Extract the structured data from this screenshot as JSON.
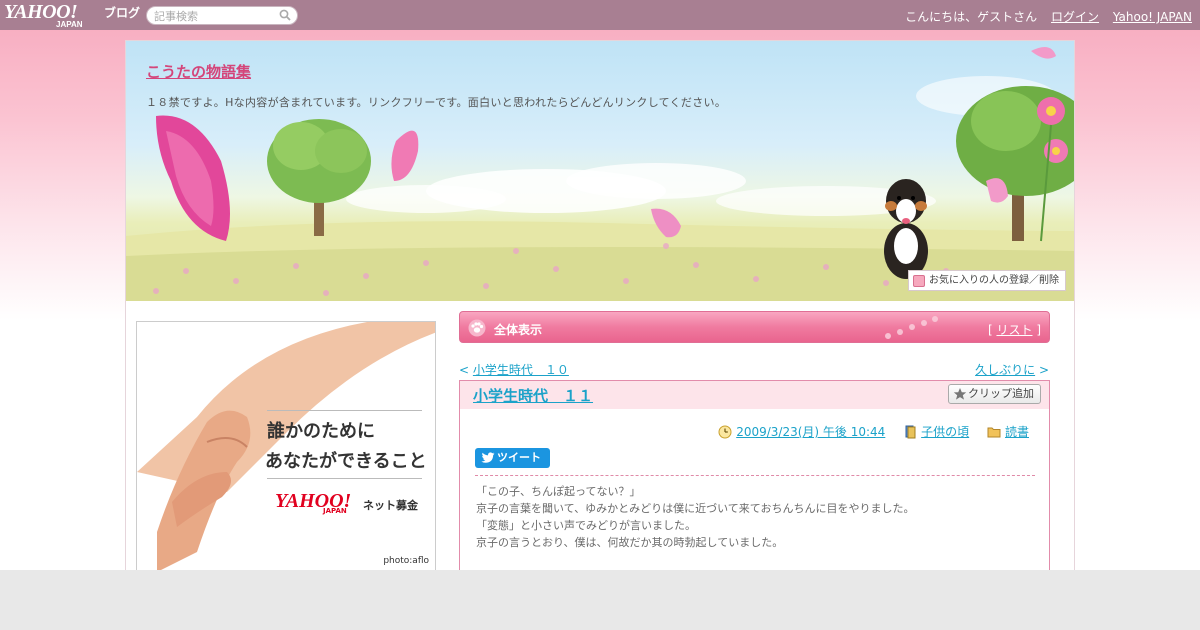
{
  "topbar": {
    "logo_main": "YAHOO!",
    "logo_sub": "JAPAN",
    "logo_service": "ブログ",
    "search_placeholder": "記事検索",
    "greeting": "こんにちは、ゲストさん",
    "login": "ログイン",
    "yahoo_japan": "Yahoo! JAPAN"
  },
  "header": {
    "blog_title": "こうたの物語集",
    "description": "１８禁ですよ。Hな内容が含まれています。リンクフリーです。面白いと思われたらどんどんリンクしてください。",
    "favorite_button": "お気に入りの人の登録／削除"
  },
  "ad": {
    "line1": "誰かのために",
    "line2": "あなたができること",
    "logo_main": "YAHOO!",
    "logo_sub": "JAPAN",
    "service": "ネット募金",
    "credit": "photo:aflo"
  },
  "listbar": {
    "label": "全体表示",
    "list_open": "[",
    "list_link": "リスト",
    "list_close": "]"
  },
  "nav": {
    "prev_arrow": "<",
    "prev_title": "小学生時代　１０",
    "next_title": "久しぶりに",
    "next_arrow": ">"
  },
  "article": {
    "title": "小学生時代　１１",
    "clip_button": "クリップ追加",
    "date": "2009/3/23(月) 午後 10:44",
    "category": "子供の頃",
    "genre": "読書",
    "tweet_button": "ツイート",
    "body": [
      "「この子、ちんぽ起ってない？」",
      "京子の言葉を聞いて、ゆみかとみどりは僕に近づいて来ておちんちんに目をやりました。",
      "「変態」と小さい声でみどりが言いました。",
      "京子の言うとおり、僕は、何故だか其の時勃起していました。",
      ""
    ]
  },
  "colors": {
    "topbar": "#a87f92",
    "accent_pink": "#e9648e",
    "link_blue": "#1ba2c9",
    "title_pink": "#d4457a"
  }
}
